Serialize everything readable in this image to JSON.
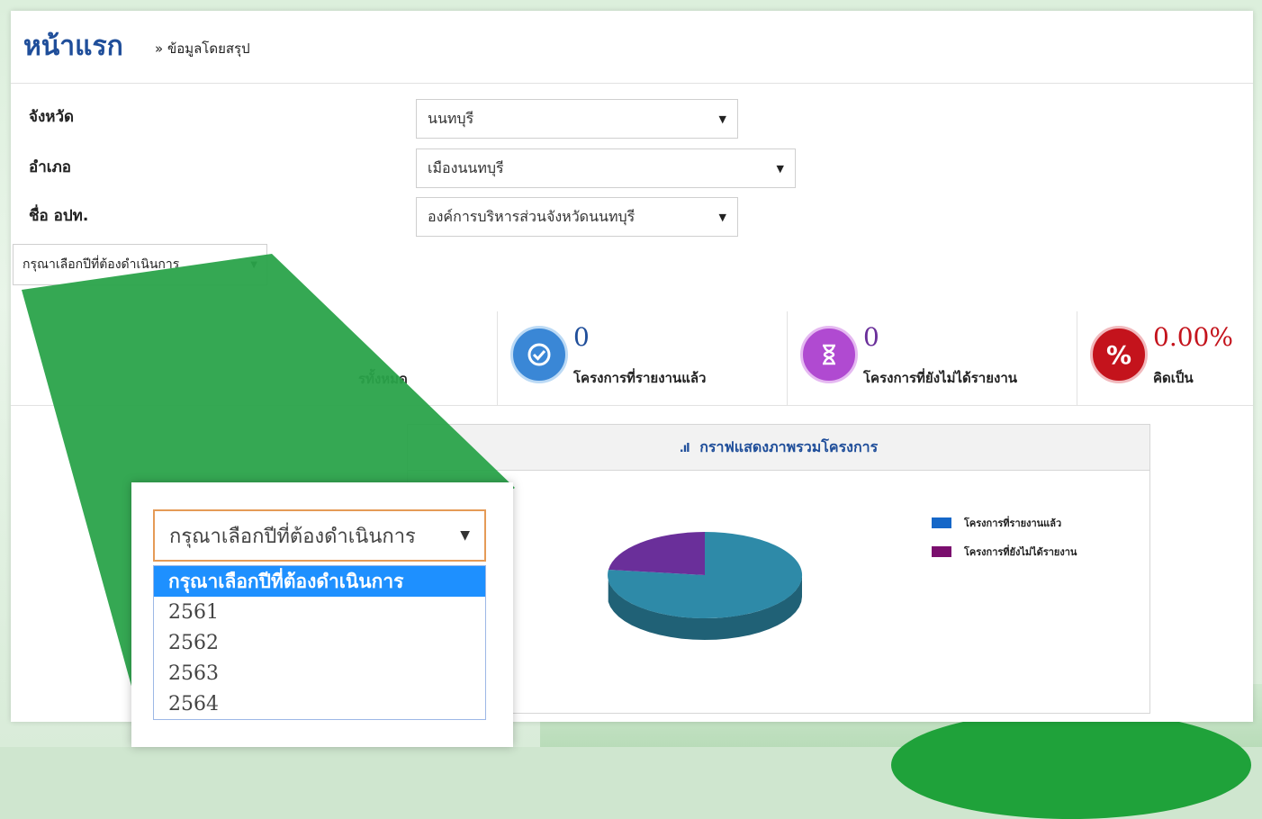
{
  "header": {
    "title": "หน้าแรก",
    "breadcrumb": "» ข้อมูลโดยสรุป"
  },
  "form": {
    "province_label": "จังหวัด",
    "province_value": "นนทบุรี",
    "district_label": "อำเภอ",
    "district_value": "เมืองนนทบุรี",
    "org_label": "ชื่อ อปท.",
    "org_value": "องค์การบริหารส่วนจังหวัดนนทบุรี",
    "year_value": "กรุณาเลือกปีที่ต้องดำเนินการ"
  },
  "stats": [
    {
      "label": "รทั้งหมด",
      "partial": true
    },
    {
      "value": "0",
      "label": "โครงการที่รายงานแล้ว",
      "color": "#3a87d6",
      "icon": "check-icon"
    },
    {
      "value": "0",
      "label": "โครงการที่ยังไม่ได้รายงาน",
      "color": "#b04ad1",
      "icon": "hourglass-icon"
    },
    {
      "value": "0.00%",
      "label": "คิดเป็น",
      "color": "#c4131c",
      "icon": "percent-icon"
    }
  ],
  "chart_data": {
    "type": "pie",
    "title": "กราฟแสดงภาพรวมโครงการ",
    "series": [
      {
        "name": "โครงการที่รายงานแล้ว",
        "value": 77,
        "color": "#2e8aa8"
      },
      {
        "name": "โครงการที่ยังไม่ได้รายงาน",
        "value": 23,
        "color": "#6a2f9a"
      }
    ],
    "legend": [
      {
        "label": "โครงการที่รายงานแล้ว",
        "color": "#1567c8"
      },
      {
        "label": "โครงการที่ยังไม่ได้รายงาน",
        "color": "#7b0f6e"
      }
    ],
    "legend_position": "top-right"
  },
  "zoom": {
    "select_value": "กรุณาเลือกปีที่ต้องดำเนินการ",
    "options": [
      "กรุณาเลือกปีที่ต้องดำเนินการ",
      "2561",
      "2562",
      "2563",
      "2564"
    ]
  }
}
